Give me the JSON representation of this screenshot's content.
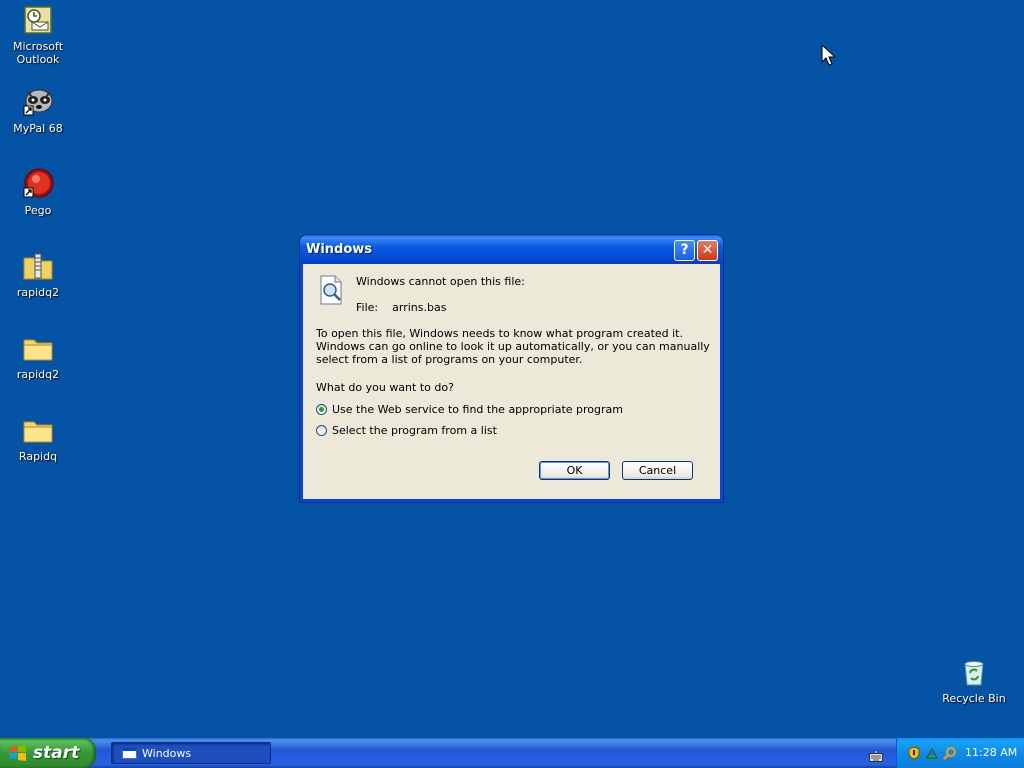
{
  "desktop": {
    "icons": [
      {
        "label": "Microsoft\nOutlook",
        "icon": "outlook-icon"
      },
      {
        "label": "MyPal 68",
        "icon": "mypal-icon"
      },
      {
        "label": "Pego",
        "icon": "pego-icon"
      },
      {
        "label": "rapidq2",
        "icon": "zip-folder-icon"
      },
      {
        "label": "rapidq2",
        "icon": "folder-icon"
      },
      {
        "label": "Rapidq",
        "icon": "folder-icon"
      },
      {
        "label": "Recycle Bin",
        "icon": "recycle-bin-icon"
      }
    ]
  },
  "dialog": {
    "title": "Windows",
    "help_glyph": "?",
    "close_glyph": "✕",
    "message_title": "Windows cannot open this file:",
    "file_label": "File:",
    "file_name": "arrins.bas",
    "explanation": "To open this file, Windows needs to know what program created it.  Windows can go online to look it up automatically, or you can manually select from a list of programs on your computer.",
    "question": "What do you want to do?",
    "options": [
      {
        "label": "Use the Web service to find the appropriate program",
        "checked": true
      },
      {
        "label": "Select the program from a list",
        "checked": false
      }
    ],
    "ok_label": "OK",
    "cancel_label": "Cancel"
  },
  "taskbar": {
    "start_label": "start",
    "tasks": [
      {
        "label": "Windows"
      }
    ],
    "clock": "11:28 AM"
  },
  "colors": {
    "desktop": "#0453a4",
    "titlebar": "#0b5ce2",
    "dialog_bg": "#ece9d8",
    "taskbar": "#2157d7",
    "start": "#379837",
    "tray": "#0d8ae9"
  }
}
